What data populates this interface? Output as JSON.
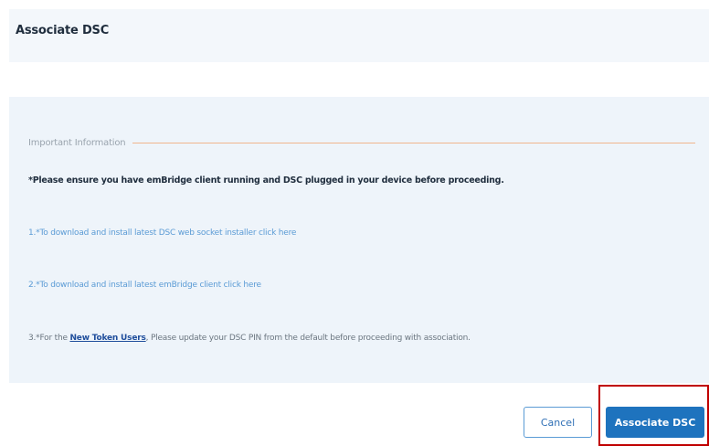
{
  "dialog": {
    "title": "Associate DSC"
  },
  "info": {
    "legend": "Important Information",
    "warning": "*Please ensure you have emBridge client running and DSC plugged in your device before proceeding.",
    "link1": "1.*To download and install latest DSC web socket installer click here",
    "link2": "2.*To download and install latest emBridge client click here",
    "line3_prefix": "3.*For the ",
    "line3_link": "New Token Users",
    "line3_suffix": ", Please update your DSC PIN from the default before proceeding with association."
  },
  "buttons": {
    "cancel": "Cancel",
    "associate": "Associate DSC"
  },
  "colors": {
    "primary": "#1e73be",
    "panel_bg": "#eef4fa",
    "link": "#5b9bd5",
    "highlight": "#c00000",
    "divider": "#f0b58e"
  }
}
